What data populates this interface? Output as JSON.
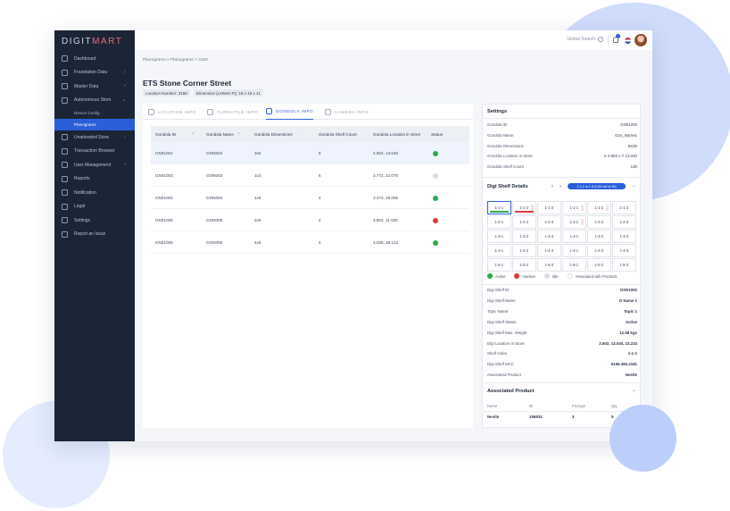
{
  "app": {
    "logo_main": "DIGIT",
    "logo_accent": "MART"
  },
  "sidebar": {
    "items": [
      {
        "label": "Dashboard",
        "icon": "dashboard-icon",
        "chevron": ""
      },
      {
        "label": "Foundation Data",
        "icon": "foundation-data-icon",
        "chevron": "›"
      },
      {
        "label": "Master Data",
        "icon": "master-data-icon",
        "chevron": "›"
      },
      {
        "label": "Autonomous Store",
        "icon": "store-icon",
        "chevron": "⌄"
      },
      {
        "label": "Device Config",
        "icon": "",
        "chevron": "›",
        "sub": true
      },
      {
        "label": "Planograms",
        "icon": "",
        "chevron": "",
        "sub": true,
        "active": true
      },
      {
        "label": "Unattended Store",
        "icon": "unattended-store-icon",
        "chevron": "›"
      },
      {
        "label": "Transaction Browser",
        "icon": "transaction-icon",
        "chevron": ""
      },
      {
        "label": "User Management",
        "icon": "user-management-icon",
        "chevron": "›"
      },
      {
        "label": "Reports",
        "icon": "reports-icon",
        "chevron": ""
      },
      {
        "label": "Notification",
        "icon": "notification-icon",
        "chevron": ""
      },
      {
        "label": "Legal",
        "icon": "legal-icon",
        "chevron": ""
      },
      {
        "label": "Settings",
        "icon": "settings-icon",
        "chevron": ""
      },
      {
        "label": "Report an Issue",
        "icon": "report-issue-icon",
        "chevron": ""
      }
    ]
  },
  "topbar": {
    "search_label": "Global Search",
    "notification_count": "2"
  },
  "breadcrumb": "Planograms  >  Planograms  >  3159",
  "page": {
    "title": "ETS Stone Corner Street",
    "location_chip": "Location Number: 3159",
    "dimension_chip": "Dimension (LxWxH Ft): 18 x 18 x 11"
  },
  "tabs": [
    {
      "label": "LOCATION INFO",
      "icon": "location-pin-icon"
    },
    {
      "label": "TURNSTILE INFO",
      "icon": "turnstile-icon"
    },
    {
      "label": "GONDOLA INFO",
      "icon": "gondola-icon",
      "active": true
    },
    {
      "label": "CAMERA INFO",
      "icon": "camera-icon"
    }
  ],
  "table": {
    "columns": [
      "Gondola ID",
      "Gondola Name",
      "Gondola Dimensions",
      "Gondola Shelf Count",
      "Gondola Location in Store",
      "Status"
    ],
    "rows": [
      [
        "GN01002",
        "GON002",
        "3x5",
        "5",
        "2.602, 13.040",
        "Active"
      ],
      [
        "GN01003",
        "GON003",
        "1x3",
        "5",
        "3.772, 22.070",
        "Idle"
      ],
      [
        "GN01004",
        "GON004",
        "1x5",
        "4",
        "3.472, 25.055",
        "Active"
      ],
      [
        "GN01005",
        "GON005",
        "2x5",
        "4",
        "3.602, 11.030",
        "Inactive"
      ],
      [
        "GN01006",
        "GON006",
        "4x5",
        "4",
        "3.035, 18.122",
        "Active"
      ]
    ]
  },
  "settings": {
    "title": "Settings",
    "fields": [
      {
        "label": "Gondola ID",
        "value": "GN01002"
      },
      {
        "label": "Gondola Name",
        "value": "Gon_Name1"
      },
      {
        "label": "Gondola Dimensions",
        "value": "5X30"
      },
      {
        "label": "Gondola Location in Store",
        "value": "X  2.602  x  Y  13.040"
      },
      {
        "label": "Gondola Shelf Count",
        "value": "130"
      }
    ]
  },
  "digi_shelf": {
    "title": "Digi Shelf Details",
    "badge": "1-1-1 to 1-5-5 (30 out of 30)",
    "grid": [
      [
        "1-1-1",
        "1-1-2",
        "1-1-3",
        "1-1-1",
        "1-1-2",
        "1-1-3"
      ],
      [
        "1-2-1",
        "1-2-2",
        "1-2-3",
        "1-2-1",
        "1-2-2",
        "1-2-3"
      ],
      [
        "1-3-1",
        "1-3-2",
        "1-3-3",
        "1-3-1",
        "1-3-2",
        "1-3-3"
      ],
      [
        "1-4-1",
        "1-4-2",
        "1-4-3",
        "1-4-1",
        "1-4-2",
        "1-4-3"
      ],
      [
        "1-5-1",
        "1-5-2",
        "1-5-3",
        "1-5-1",
        "1-5-2",
        "1-5-3"
      ]
    ],
    "legend": [
      "Active",
      "Inactive",
      "Idle",
      "Associated with Products"
    ],
    "fields": [
      {
        "label": "Digi Shelf ID",
        "value": "DSN1002"
      },
      {
        "label": "Digi Shelf Name",
        "value": "D Name 1"
      },
      {
        "label": "Topic Name",
        "value": "Topic 1"
      },
      {
        "label": "Digi Shelf Status",
        "value": "Active"
      },
      {
        "label": "Digi Shelf Max. Weight",
        "value": "12.58 kgs"
      },
      {
        "label": "Digi Location in Store",
        "value": "2.602, 13.040, 23.234"
      },
      {
        "label": "Shelf Index",
        "value": "1-1-1"
      },
      {
        "label": "Digi Shelf MAC",
        "value": "6166.366.2181"
      },
      {
        "label": "Associated Product",
        "value": "Nestle"
      }
    ]
  },
  "associated_product": {
    "title": "Associated Product",
    "columns": [
      "Name",
      "ID",
      "Facings",
      "Qty"
    ],
    "row": [
      "Nestle",
      "156834",
      "3",
      "5"
    ]
  },
  "colors": {
    "active": "#2fa84f",
    "inactive": "#e0383e",
    "idle": "#d9dde3",
    "accent": "#2b5fd9",
    "sidebar": "#1c2536"
  }
}
